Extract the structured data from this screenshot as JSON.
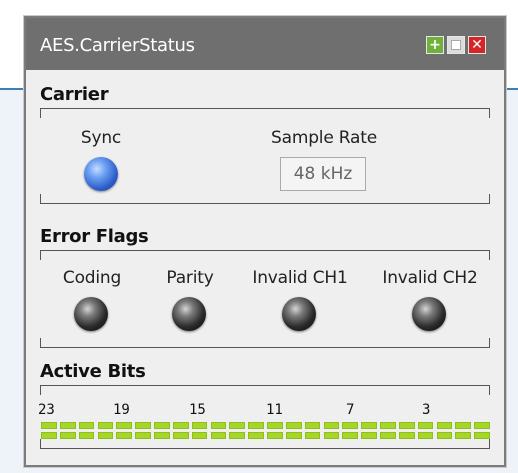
{
  "window": {
    "title": "AES.CarrierStatus",
    "buttons": [
      "add",
      "dock",
      "close"
    ]
  },
  "carrier": {
    "heading": "Carrier",
    "sync_label": "Sync",
    "sync_led": "on",
    "sample_rate_label": "Sample Rate",
    "sample_rate_value": "48 kHz"
  },
  "error_flags": {
    "heading": "Error Flags",
    "flags": [
      {
        "label": "Coding",
        "state": "off"
      },
      {
        "label": "Parity",
        "state": "off"
      },
      {
        "label": "Invalid CH1",
        "state": "off"
      },
      {
        "label": "Invalid CH2",
        "state": "off"
      }
    ]
  },
  "active_bits": {
    "heading": "Active Bits",
    "bit_numbers": [
      "23",
      "19",
      "15",
      "11",
      "7",
      "3"
    ],
    "bit_count": 24,
    "active_color": "#a7d62a"
  },
  "colors": {
    "titlebar": "#6f6f6f",
    "close": "#d52626",
    "add": "#6fb13a",
    "sync_on": "#2d5fcc"
  }
}
